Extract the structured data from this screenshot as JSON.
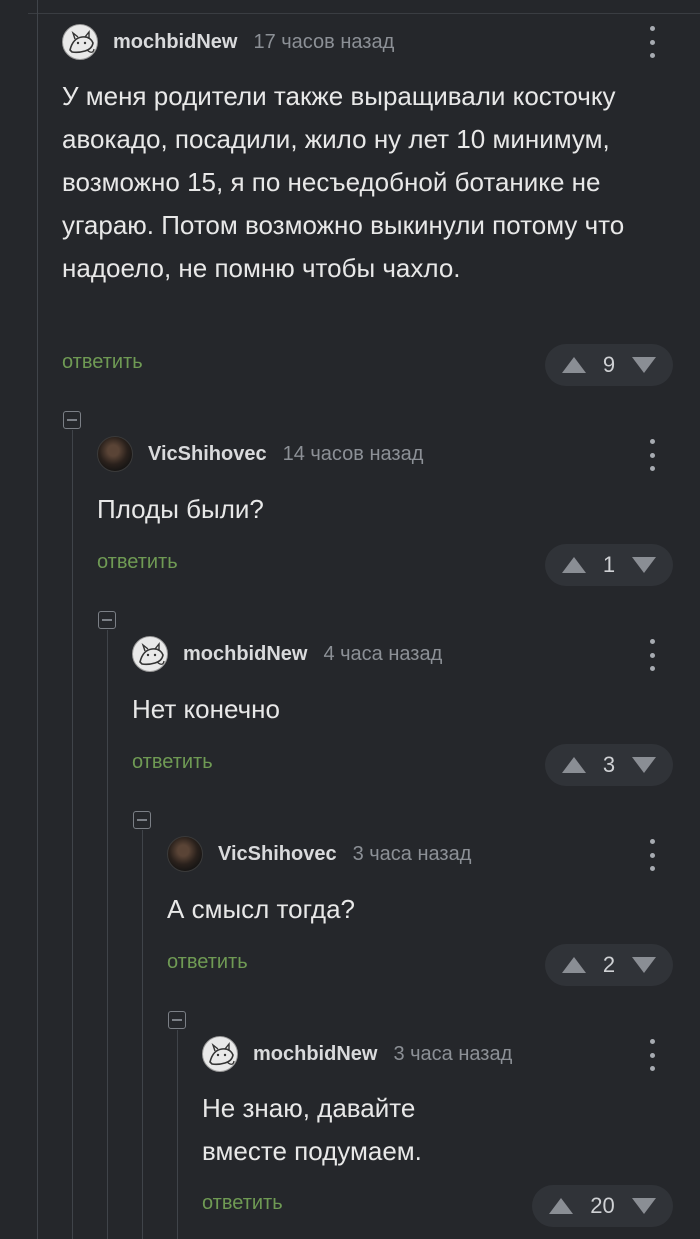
{
  "comments": [
    {
      "username": "mochbidNew",
      "time": "17 часов назад",
      "text": "У меня родители также выращивали косточку авокадо, посадили, жило ну лет 10 минимум, возможно 15, я по несъедобной ботанике не угараю. Потом возможно выкинули потому что надоело, не помню чтобы чахло.",
      "reply": "ответить",
      "votes": "9"
    },
    {
      "username": "VicShihovec",
      "time": "14 часов назад",
      "text": "Плоды были?",
      "reply": "ответить",
      "votes": "1"
    },
    {
      "username": "mochbidNew",
      "time": "4 часа назад",
      "text": "Нет конечно",
      "reply": "ответить",
      "votes": "3"
    },
    {
      "username": "VicShihovec",
      "time": "3 часа назад",
      "text": "А смысл тогда?",
      "reply": "ответить",
      "votes": "2"
    },
    {
      "username": "mochbidNew",
      "time": "3 часа назад",
      "text": "Не знаю, давайте вместе подумаем.",
      "reply": "ответить",
      "votes": "20"
    }
  ],
  "icons": {
    "avatar_light": "cat-sketch-avatar",
    "avatar_dark": "dark-photo-avatar",
    "upvote": "triangle-up",
    "downvote": "triangle-down",
    "menu": "vertical-dots"
  },
  "colors": {
    "background": "#25272b",
    "reply_link": "#6f9a54",
    "pill": "#303338"
  }
}
